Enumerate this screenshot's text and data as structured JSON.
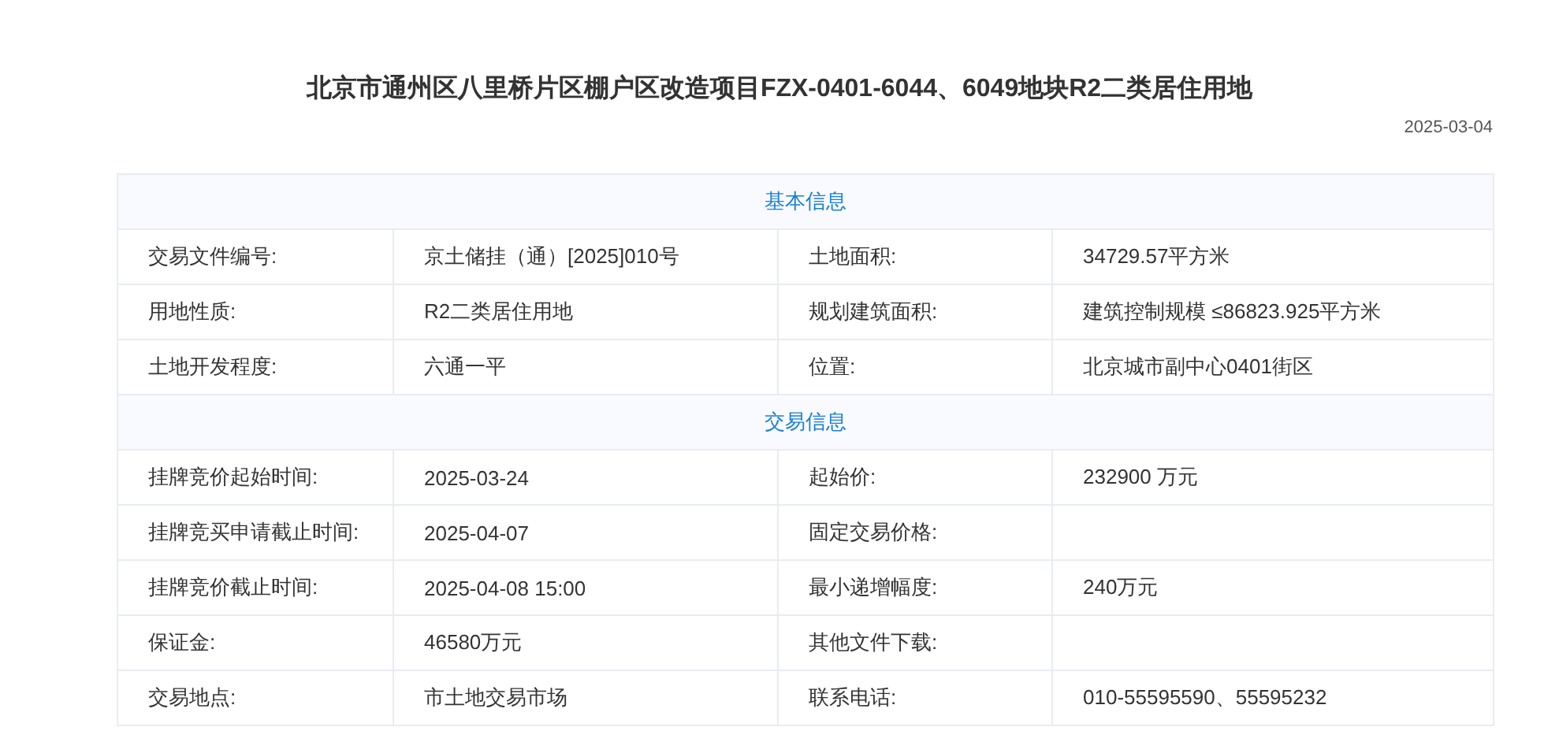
{
  "title": "北京市通州区八里桥片区棚户区改造项目FZX-0401-6044、6049地块R2二类居住用地",
  "date": "2025-03-04",
  "sections": [
    {
      "title": "基本信息",
      "rows": [
        [
          {
            "label": "交易文件编号:",
            "value": "京土储挂（通）[2025]010号"
          },
          {
            "label": "土地面积:",
            "value": "34729.57平方米"
          }
        ],
        [
          {
            "label": "用地性质:",
            "value": "R2二类居住用地"
          },
          {
            "label": "规划建筑面积:",
            "value": "建筑控制规模 ≤86823.925平方米"
          }
        ],
        [
          {
            "label": "土地开发程度:",
            "value": "六通一平"
          },
          {
            "label": "位置:",
            "value": "北京城市副中心0401街区"
          }
        ]
      ]
    },
    {
      "title": "交易信息",
      "rows": [
        [
          {
            "label": "挂牌竞价起始时间:",
            "value": "2025-03-24"
          },
          {
            "label": "起始价:",
            "value": "232900 万元"
          }
        ],
        [
          {
            "label": "挂牌竞买申请截止时间:",
            "value": "2025-04-07"
          },
          {
            "label": "固定交易价格:"
          }
        ],
        [
          {
            "label": "挂牌竞价截止时间:",
            "value": "2025-04-08 15:00"
          },
          {
            "label": "最小递增幅度:",
            "value": "240万元"
          }
        ],
        [
          {
            "label": "保证金:",
            "value": "46580万元"
          },
          {
            "label": "其他文件下载:"
          }
        ],
        [
          {
            "label": "交易地点:",
            "value": "市土地交易市场"
          },
          {
            "label": "联系电话:",
            "value": "010-55595590、55595232"
          }
        ]
      ]
    }
  ]
}
